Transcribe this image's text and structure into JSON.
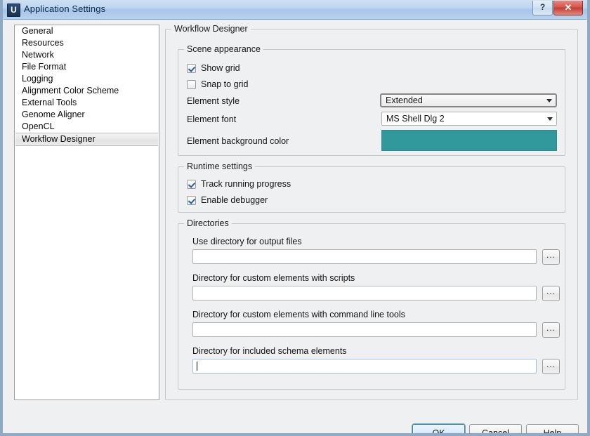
{
  "window": {
    "title": "Application Settings",
    "icon": "U",
    "help_button": "?",
    "close_button": "✕"
  },
  "sidebar": {
    "items": [
      {
        "label": "General",
        "selected": false
      },
      {
        "label": "Resources",
        "selected": false
      },
      {
        "label": "Network",
        "selected": false
      },
      {
        "label": "File Format",
        "selected": false
      },
      {
        "label": "Logging",
        "selected": false
      },
      {
        "label": "Alignment Color Scheme",
        "selected": false
      },
      {
        "label": "External Tools",
        "selected": false
      },
      {
        "label": "Genome Aligner",
        "selected": false
      },
      {
        "label": "OpenCL",
        "selected": false
      },
      {
        "label": "Workflow Designer",
        "selected": true
      }
    ]
  },
  "page": {
    "title": "Workflow Designer",
    "scene_appearance": {
      "title": "Scene appearance",
      "show_grid": {
        "label": "Show grid",
        "checked": true
      },
      "snap_to_grid": {
        "label": "Snap to grid",
        "checked": false
      },
      "element_style": {
        "label": "Element style",
        "value": "Extended",
        "focused": true
      },
      "element_font": {
        "label": "Element font",
        "value": "MS Shell Dlg 2",
        "focused": false
      },
      "element_background_color": {
        "label": "Element background color",
        "color": "#31999b"
      }
    },
    "runtime_settings": {
      "title": "Runtime settings",
      "track_running_progress": {
        "label": "Track running progress",
        "checked": true
      },
      "enable_debugger": {
        "label": "Enable debugger",
        "checked": true
      }
    },
    "directories": {
      "title": "Directories",
      "browse_label": "...",
      "fields": [
        {
          "label": "Use directory for output files",
          "value": "",
          "focused": false
        },
        {
          "label": "Directory for custom elements with scripts",
          "value": "",
          "focused": false
        },
        {
          "label": "Directory for custom elements with command line tools",
          "value": "",
          "focused": false
        },
        {
          "label": "Directory for included schema elements",
          "value": "",
          "focused": true
        }
      ]
    }
  },
  "footer": {
    "ok": "OK",
    "cancel": "Cancel",
    "help": "Help"
  }
}
